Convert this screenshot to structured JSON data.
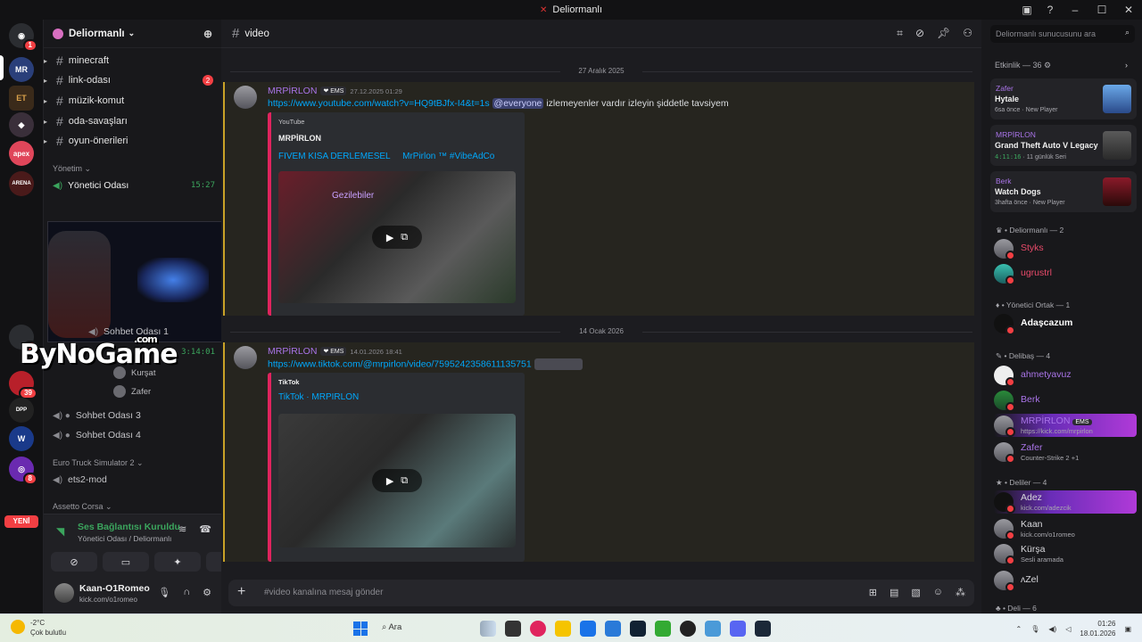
{
  "window": {
    "title": "Deliormanlı"
  },
  "rail": {
    "new_label": "YENİ",
    "badges": [
      "1",
      "1",
      "39",
      "8"
    ]
  },
  "sidebar": {
    "guild_name": "Deliormanlı",
    "channels": [
      {
        "name": "minecraft",
        "badge": ""
      },
      {
        "name": "link-odası",
        "badge": "2"
      },
      {
        "name": "müzik-komut",
        "badge": ""
      },
      {
        "name": "oda-savaşları",
        "badge": ""
      },
      {
        "name": "oyun-önerileri",
        "badge": ""
      }
    ],
    "category_yonetim": "Yönetim",
    "voice_yonetici": {
      "name": "Yönetici Odası",
      "time": "15:27"
    },
    "voice_sohbet1": {
      "name": "Sohbet Odası 1",
      "time": "3:14:01"
    },
    "voice_users": [
      {
        "name": "Kurşat"
      },
      {
        "name": "Zafer"
      }
    ],
    "voice_sohbet3": "Sohbet Odası 3",
    "voice_sohbet4": "Sohbet Odası 4",
    "category_ets": "Euro Truck Simulator 2",
    "ets_channel": "ets2-mod",
    "category_assetto": "Assetto Corsa"
  },
  "overlay": {
    "brand": "ByNoGame",
    "dotcom": ".com"
  },
  "voice_panel": {
    "status": "Ses Bağlantısı Kuruldu",
    "location": "Yönetici Odası / Deliormanlı"
  },
  "user_panel": {
    "name": "Kaan-O1Romeo",
    "status": "kick.com/o1romeo"
  },
  "main": {
    "channel": "video",
    "date1": "27 Aralık 2025",
    "msg1": {
      "author": "MRPİRLON",
      "tag": "EMS",
      "time": "27.12.2025 01:29",
      "link": "https://www.youtube.com/watch?v=HQ9tBJfx-I4&t=1s",
      "mention": "@everyone",
      "text": "izlemeyenler vardır izleyin şiddetle tavsiyem",
      "embed_provider": "YouTube",
      "embed_author": "MRPİRLON",
      "embed_title": "FIVEM KISA DERLEMESEL     MrPirlon ™ #VibeAdCo",
      "thumb_caption": "Gezilebiler"
    },
    "date2": "14 Ocak 2026",
    "msg2": {
      "author": "MRPİRLON",
      "tag": "EMS",
      "time": "14.01.2026 18:41",
      "link": "https://www.tiktok.com/@mrpirlon/video/7595242358611135751",
      "embed_provider": "TikTok",
      "embed_title": "TikTok · MRPIRLON"
    },
    "composer_placeholder": "#video kanalına mesaj gönder"
  },
  "members": {
    "search_placeholder": "Deliormanlı sunucusunu ara",
    "activity_header": "Etkinlik — 36",
    "activities": [
      {
        "user": "Zafer",
        "game": "Hytale",
        "meta": "6sa önce",
        "extra": "New Player",
        "color": "#4a8fd8"
      },
      {
        "user": "MRPİRLON",
        "game": "Grand Theft Auto V Legacy",
        "timer": "4:11:16",
        "extra": "11 günlük Seri",
        "color": "#3a3a3a"
      },
      {
        "user": "Berk",
        "game": "Watch Dogs",
        "meta": "3hafta önce",
        "extra": "New Player",
        "color": "#5a1a22"
      }
    ],
    "groups": [
      {
        "title": "Deliormanlı — 2"
      },
      {
        "title": "Yönetici Ortak — 1"
      },
      {
        "title": "Delibaş — 4"
      },
      {
        "title": "Deliler — 4"
      },
      {
        "title": "Deli — 6"
      }
    ],
    "list": [
      {
        "name": "Styks",
        "status": ""
      },
      {
        "name": "ugrustrl",
        "status": ""
      },
      {
        "name": "Adaşcazum",
        "status": ""
      },
      {
        "name": "ahmetyavuz",
        "status": ""
      },
      {
        "name": "Berk",
        "status": ""
      },
      {
        "name": "MRPİRLON",
        "status": "https://kick.com/mrpirlon",
        "tag": "EMS"
      },
      {
        "name": "Zafer",
        "status": "Counter-Strike 2 +1"
      },
      {
        "name": "Adez",
        "status": "kick.com/adezcik"
      },
      {
        "name": "Kaan",
        "status": "kick.com/o1romeo"
      },
      {
        "name": "Kürşa",
        "status": "Sesli aramada"
      },
      {
        "name": "ᴧZel",
        "status": ""
      }
    ]
  },
  "taskbar": {
    "temp": "-2°C",
    "weather": "Çok bulutlu",
    "search": "Ara",
    "time": "01:26",
    "date": "18.01.2026",
    "accent": "#1a73e8"
  }
}
